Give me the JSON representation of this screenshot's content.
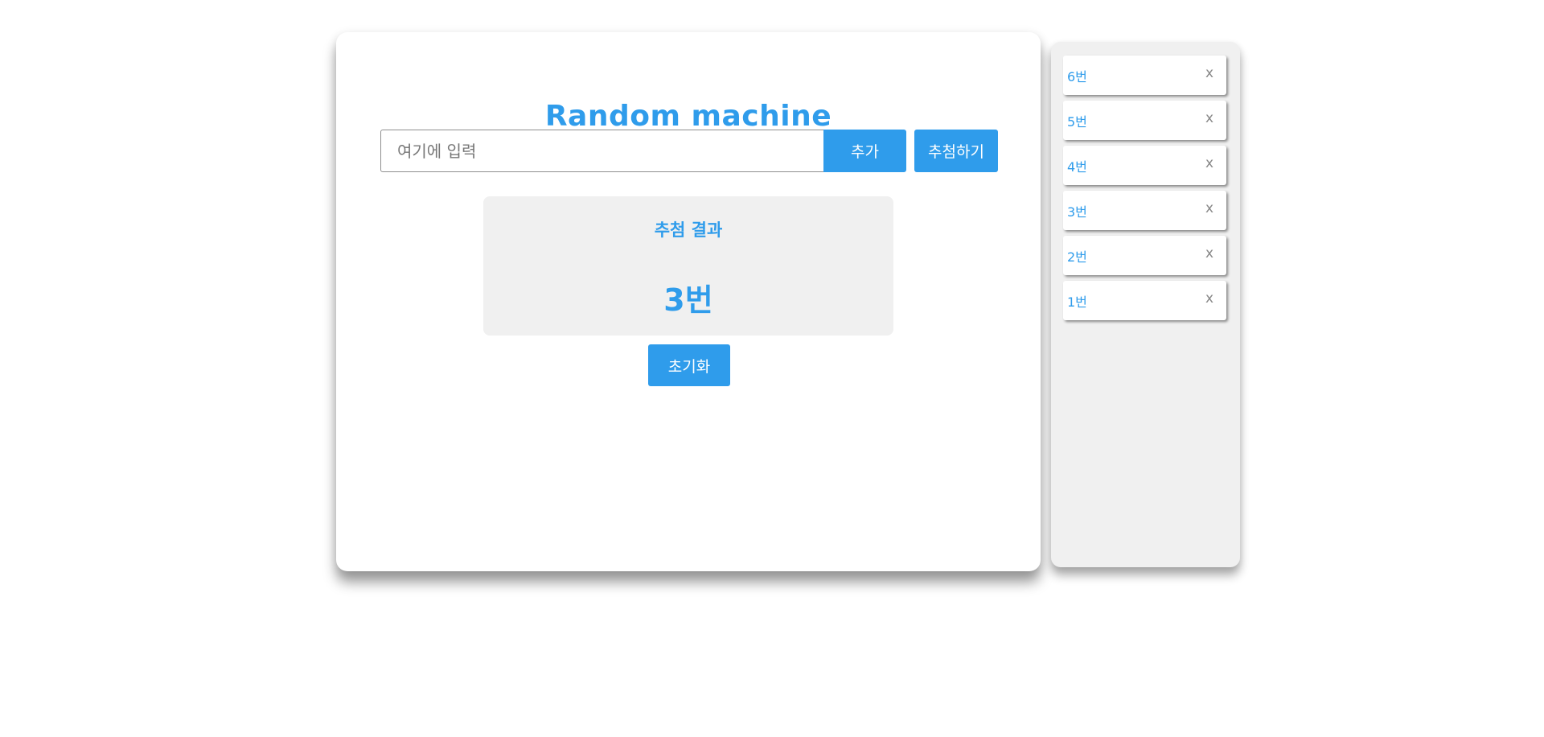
{
  "app": {
    "title": "Random machine"
  },
  "input": {
    "placeholder": "여기에 입력",
    "value": ""
  },
  "buttons": {
    "add_label": "추가",
    "draw_label": "추첨하기",
    "reset_label": "초기화"
  },
  "result": {
    "title": "추첨 결과",
    "value": "3번"
  },
  "list": {
    "items": [
      {
        "label": "6번",
        "close": "x"
      },
      {
        "label": "5번",
        "close": "x"
      },
      {
        "label": "4번",
        "close": "x"
      },
      {
        "label": "3번",
        "close": "x"
      },
      {
        "label": "2번",
        "close": "x"
      },
      {
        "label": "1번",
        "close": "x"
      }
    ]
  },
  "colors": {
    "accent": "#2f9ceb",
    "panel_background": "#f0f0f0",
    "close_icon": "#888888"
  },
  "icons": {
    "remove": "close-icon"
  }
}
